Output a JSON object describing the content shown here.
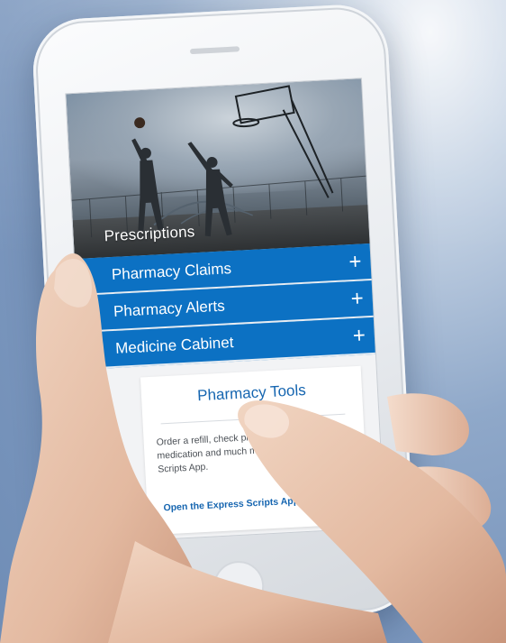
{
  "hero": {
    "title": "Prescriptions"
  },
  "accordion": {
    "items": [
      {
        "label": "Pharmacy Claims",
        "icon": "plus-icon",
        "expand_symbol": "+"
      },
      {
        "label": "Pharmacy Alerts",
        "icon": "plus-icon",
        "expand_symbol": "+"
      },
      {
        "label": "Medicine Cabinet",
        "icon": "plus-icon",
        "expand_symbol": "+"
      }
    ]
  },
  "pharmacy_tools": {
    "title": "Pharmacy Tools",
    "description": "Order a refill, check prescription to home medication and much more with the Express Scripts App.",
    "link_label": "Open the Express Scripts App",
    "link_icon": "external-link-icon"
  },
  "colors": {
    "accordion_blue": "#0c71c3",
    "link_blue": "#1565b0",
    "accent_orange": "#e8752a"
  }
}
